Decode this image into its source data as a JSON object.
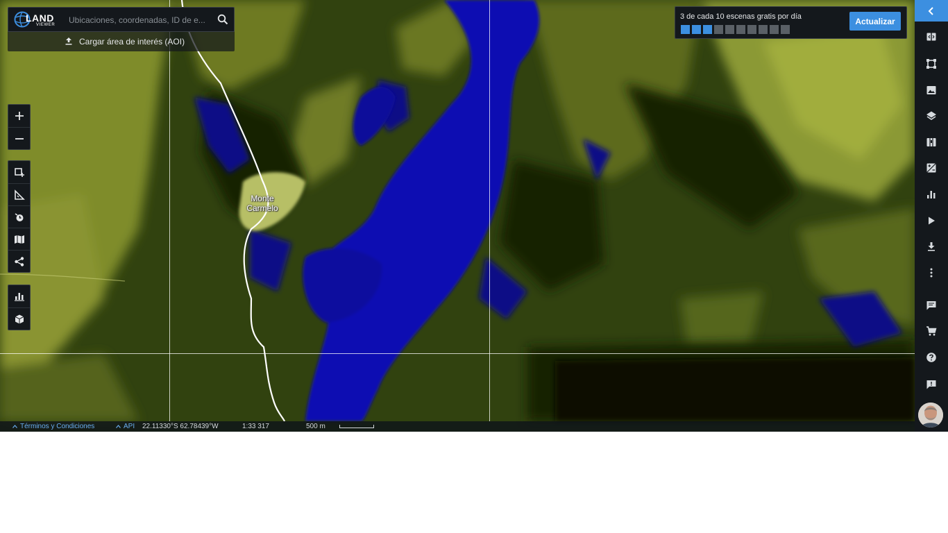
{
  "search": {
    "logo_primary": "LAND",
    "logo_secondary": "VIEWER",
    "placeholder": "Ubicaciones, coordenadas, ID de e...",
    "aoi_label": "Cargar área de interés (AOI)"
  },
  "map": {
    "place_label_line1": "Monte",
    "place_label_line2": "Carmelo"
  },
  "scenes": {
    "text": "3 de cada 10 escenas gratis por día",
    "used": 3,
    "total": 10,
    "update_label": "Actualizar",
    "accent_color": "#3c8fe0"
  },
  "left_tools": {
    "zoom": [
      "plus-icon",
      "minus-icon"
    ],
    "analysis": [
      "aoi-draw-icon",
      "measure-icon",
      "time-icon",
      "map-icon",
      "share-icon"
    ],
    "extra": [
      "bar-chart-icon",
      "cube-icon"
    ]
  },
  "sidebar": {
    "icons": [
      "chevron-left-icon",
      "compare-icon",
      "crop-icon",
      "image-icon",
      "layers-icon",
      "map-book-icon",
      "exposure-icon",
      "chart-icon",
      "play-icon",
      "download-icon",
      "more-vert-icon",
      "comment-icon",
      "cart-icon",
      "help-icon",
      "feedback-icon",
      "avatar"
    ]
  },
  "status": {
    "terms": "Términos y Condiciones",
    "api": "API",
    "coords": "22.11330°S 62.78439°W",
    "scale_ratio": "1:33 317",
    "scale_distance": "500 m"
  }
}
